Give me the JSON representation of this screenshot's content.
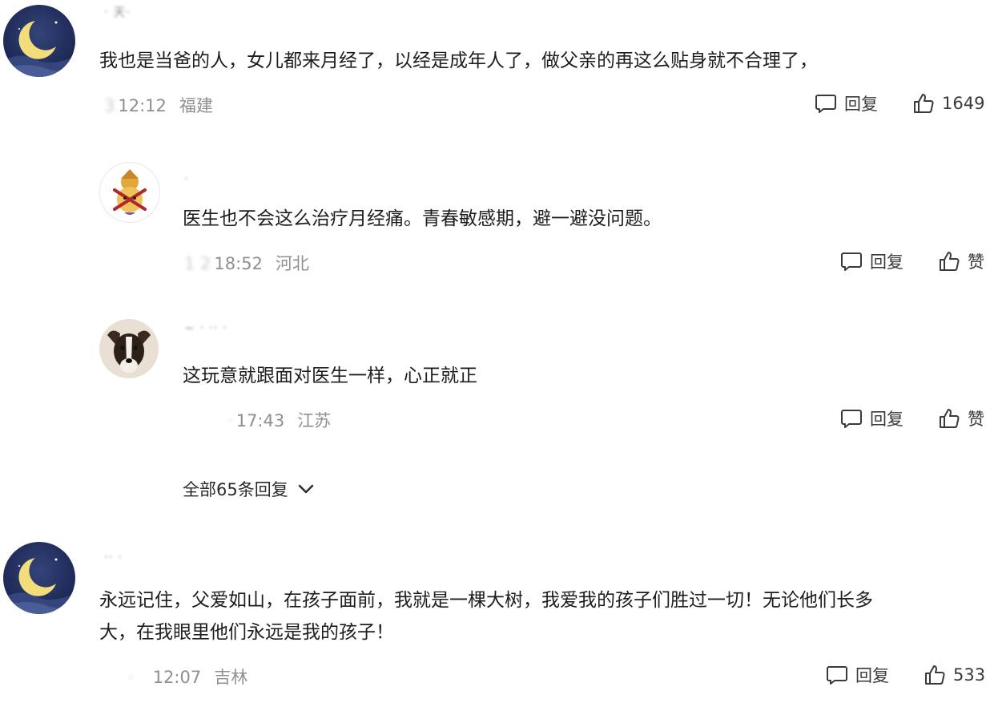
{
  "comments": [
    {
      "avatar_icon": "moon-night-avatar-icon",
      "username": "· 天·",
      "text": "我也是当爸的人，女儿都来月经了，以经是成年人了，做父亲的再这么贴身就不合理了，",
      "date_masked": "3",
      "time": "12:12",
      "location": "福建",
      "reply_label": "回复",
      "like_label": "1649"
    },
    {
      "avatar_icon": "cartoon-character-avatar-icon",
      "username": "·",
      "text": "医生也不会这么治疗月经痛。青春敏感期，避一避没问题。",
      "date_masked": "1 2",
      "time": "18:52",
      "location": "河北",
      "reply_label": "回复",
      "like_label": "赞"
    },
    {
      "avatar_icon": "dog-avatar-icon",
      "username": "~ ·  ·· ·",
      "text": "这玩意就跟面对医生一样，心正就正",
      "date_masked": "·",
      "time": "17:43",
      "location": "江苏",
      "reply_label": "回复",
      "like_label": "赞"
    },
    {
      "avatar_icon": "moon-night-avatar-icon",
      "username": "·· ·",
      "text_line1": "永远记住，父爱如山，在孩子面前，我就是一棵大树，我爱我的孩子们胜过一切！无论他们长多",
      "text_line2": "大，在我眼里他们永远是我的孩子！",
      "date_masked": "·",
      "time": "12:07",
      "location": "吉林",
      "reply_label": "回复",
      "like_label": "533"
    }
  ],
  "replies_toggle": {
    "label": "全部65条回复",
    "icon": "chevron-down-icon"
  },
  "colors": {
    "text": "#1d1d1d",
    "meta": "#8f8f8f",
    "action": "#3a3a3a",
    "moon_bg": "#22305e",
    "moon": "#f3dc7a"
  }
}
